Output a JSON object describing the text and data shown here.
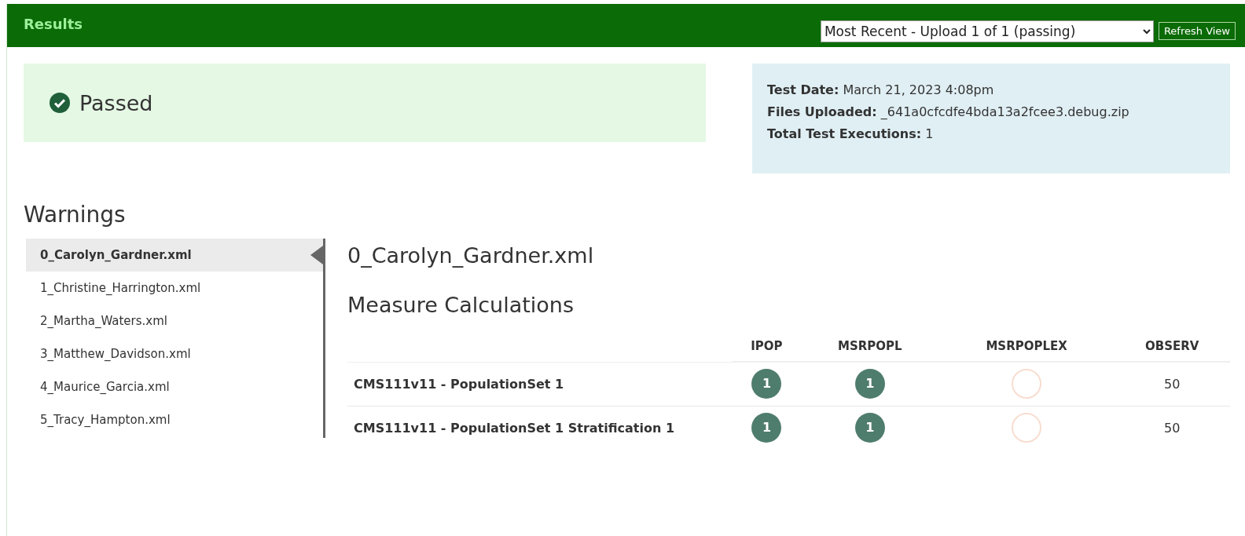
{
  "header": {
    "title": "Results",
    "upload_select": {
      "value": "Most Recent - Upload 1 of 1 (passing)"
    },
    "refresh_button": "Refresh View"
  },
  "status": {
    "label": "Passed",
    "passed": true
  },
  "info": [
    {
      "label": "Test Date:",
      "value": "March 21, 2023 4:08pm"
    },
    {
      "label": "Files Uploaded:",
      "value": "_641a0cfcdfe4bda13a2fcee3.debug.zip"
    },
    {
      "label": "Total Test Executions:",
      "value": "1"
    }
  ],
  "warnings": {
    "title": "Warnings",
    "files": [
      {
        "label": "0_Carolyn_Gardner.xml",
        "selected": true
      },
      {
        "label": "1_Christine_Harrington.xml",
        "selected": false
      },
      {
        "label": "2_Martha_Waters.xml",
        "selected": false
      },
      {
        "label": "3_Matthew_Davidson.xml",
        "selected": false
      },
      {
        "label": "4_Maurice_Garcia.xml",
        "selected": false
      },
      {
        "label": "5_Tracy_Hampton.xml",
        "selected": false
      }
    ]
  },
  "detail": {
    "file_title": "0_Carolyn_Gardner.xml",
    "section_title": "Measure Calculations",
    "table": {
      "columns": [
        "IPOP",
        "MSRPOPL",
        "MSRPOPLEX",
        "OBSERV"
      ],
      "rows": [
        {
          "name": "CMS111v11 - PopulationSet 1",
          "cells": [
            {
              "kind": "badge",
              "value": "1"
            },
            {
              "kind": "badge",
              "value": "1"
            },
            {
              "kind": "empty"
            },
            {
              "kind": "text",
              "value": "50"
            }
          ]
        },
        {
          "name": "CMS111v11 - PopulationSet 1 Stratification 1",
          "cells": [
            {
              "kind": "badge",
              "value": "1"
            },
            {
              "kind": "badge",
              "value": "1"
            },
            {
              "kind": "empty"
            },
            {
              "kind": "text",
              "value": "50"
            }
          ]
        }
      ]
    }
  }
}
